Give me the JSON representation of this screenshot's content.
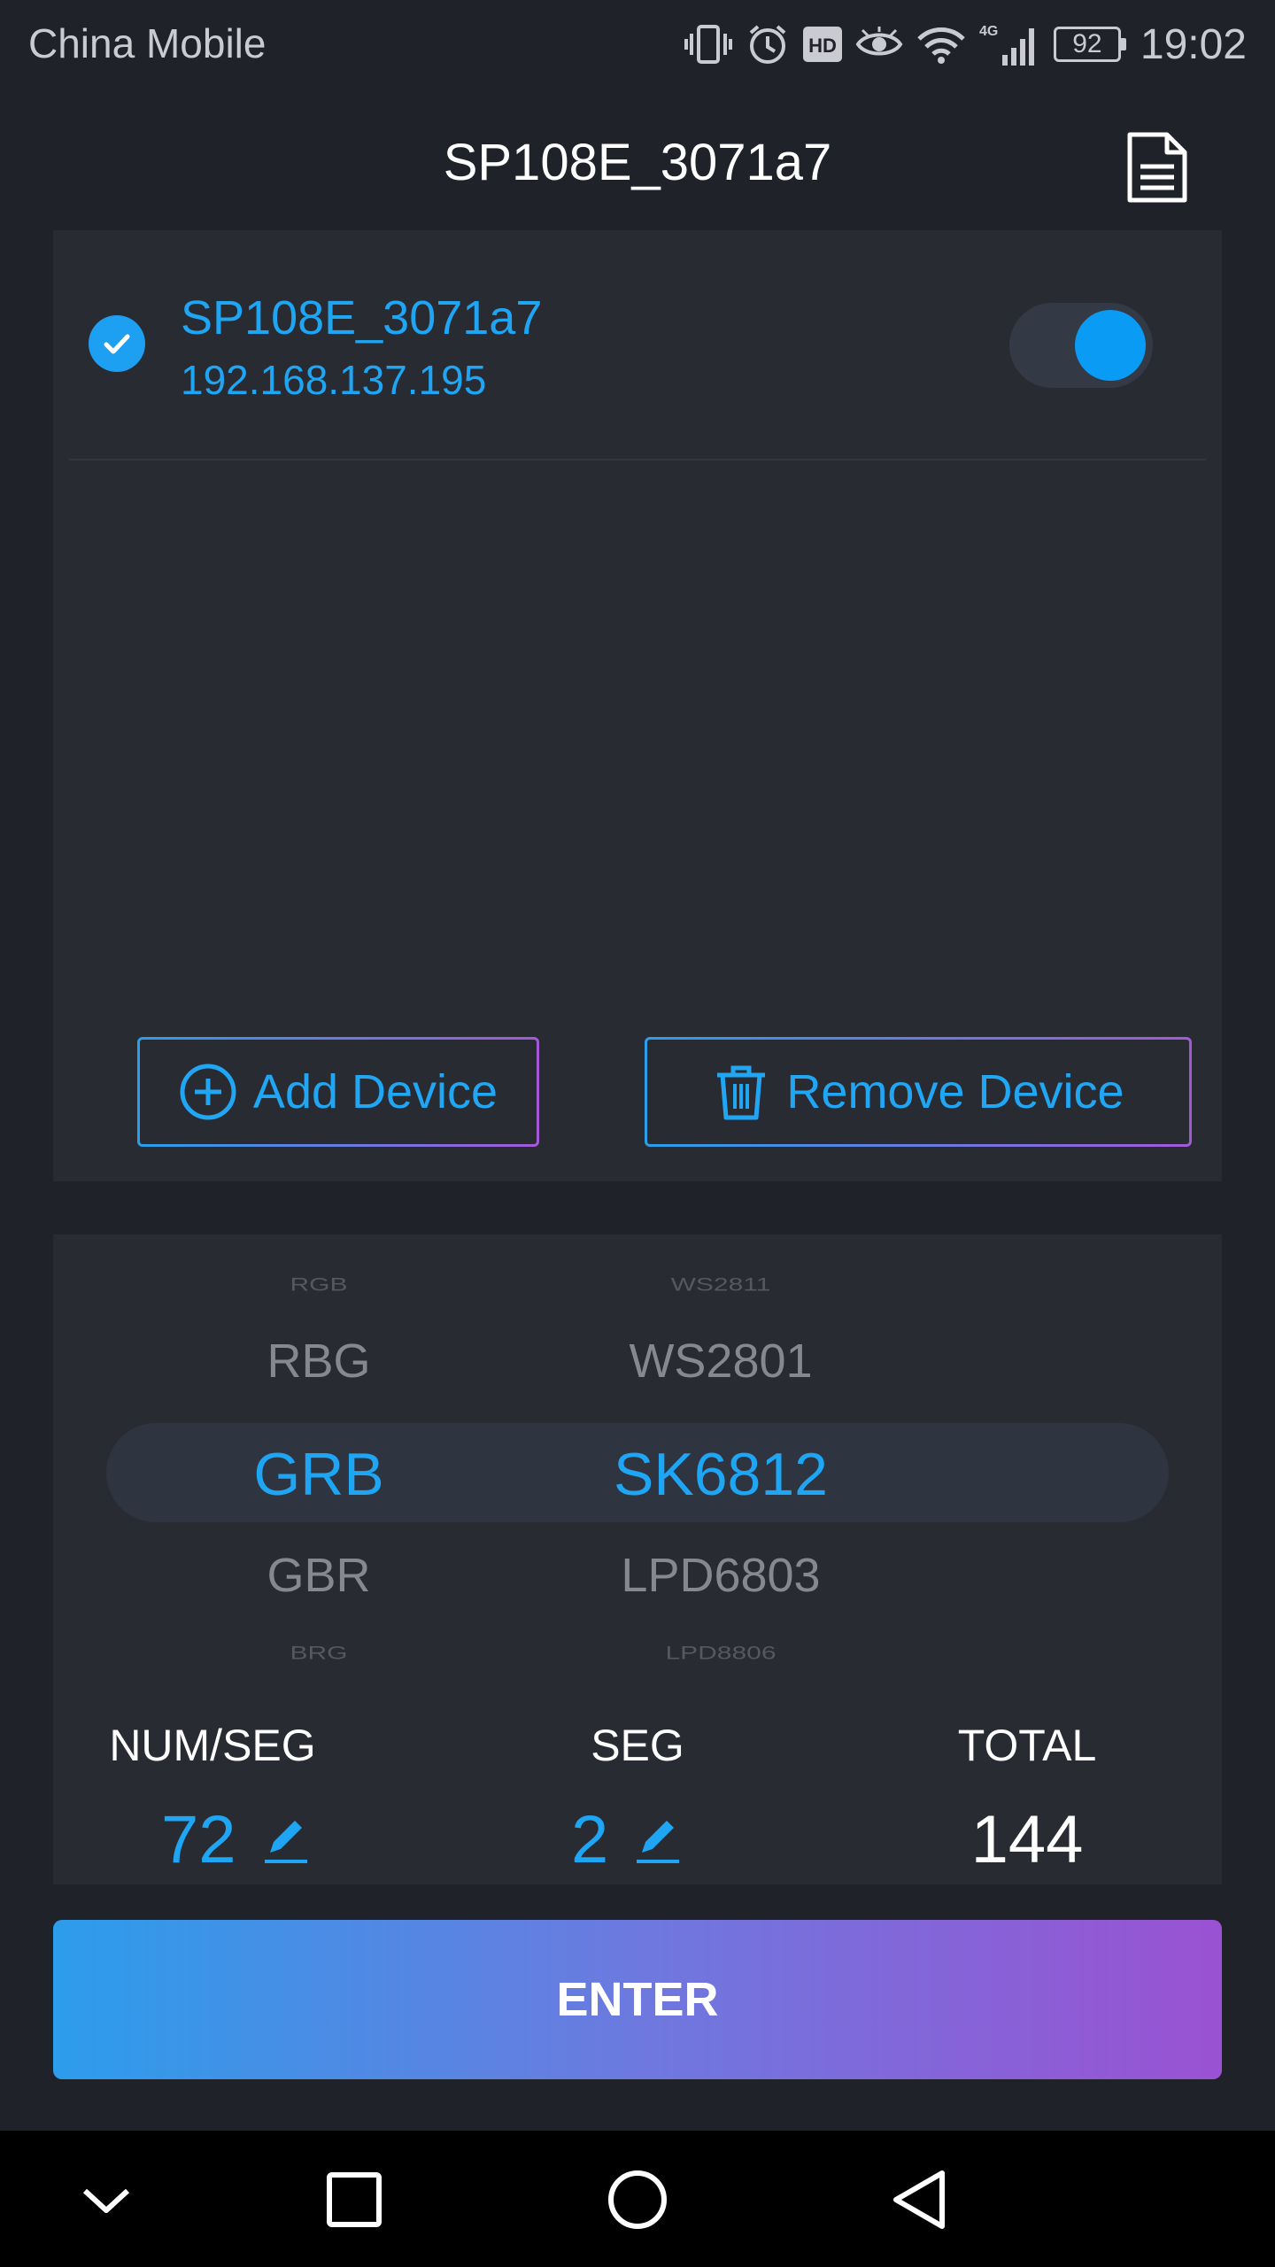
{
  "status_bar": {
    "carrier": "China Mobile",
    "battery": "92",
    "time": "19:02",
    "icons": [
      "vibrate-icon",
      "alarm-icon",
      "hd-icon",
      "eye-icon",
      "wifi-icon",
      "signal-4g-icon",
      "battery-icon"
    ]
  },
  "header": {
    "title": "SP108E_3071a7",
    "document_icon": "document-icon"
  },
  "device": {
    "name": "SP108E_3071a7",
    "ip": "192.168.137.195",
    "selected": true,
    "power_on": true
  },
  "actions": {
    "add_label": "Add Device",
    "remove_label": "Remove Device"
  },
  "picker": {
    "color_order": {
      "far_above": "RGB",
      "above": "RBG",
      "selected": "GRB",
      "below": "GBR",
      "far_below": "BRG"
    },
    "chip": {
      "far_above": "WS2811",
      "above": "WS2801",
      "selected": "SK6812",
      "below": "LPD6803",
      "far_below": "LPD8806"
    }
  },
  "stats": {
    "num_seg_label": "NUM/SEG",
    "num_seg_value": "72",
    "seg_label": "SEG",
    "seg_value": "2",
    "total_label": "TOTAL",
    "total_value": "144"
  },
  "enter_label": "ENTER",
  "colors": {
    "accent_blue": "#1ea6f5",
    "panel_bg": "#292b33",
    "page_bg": "#202229",
    "gradient_start": "#2c9deb",
    "gradient_end": "#9a52d2"
  }
}
